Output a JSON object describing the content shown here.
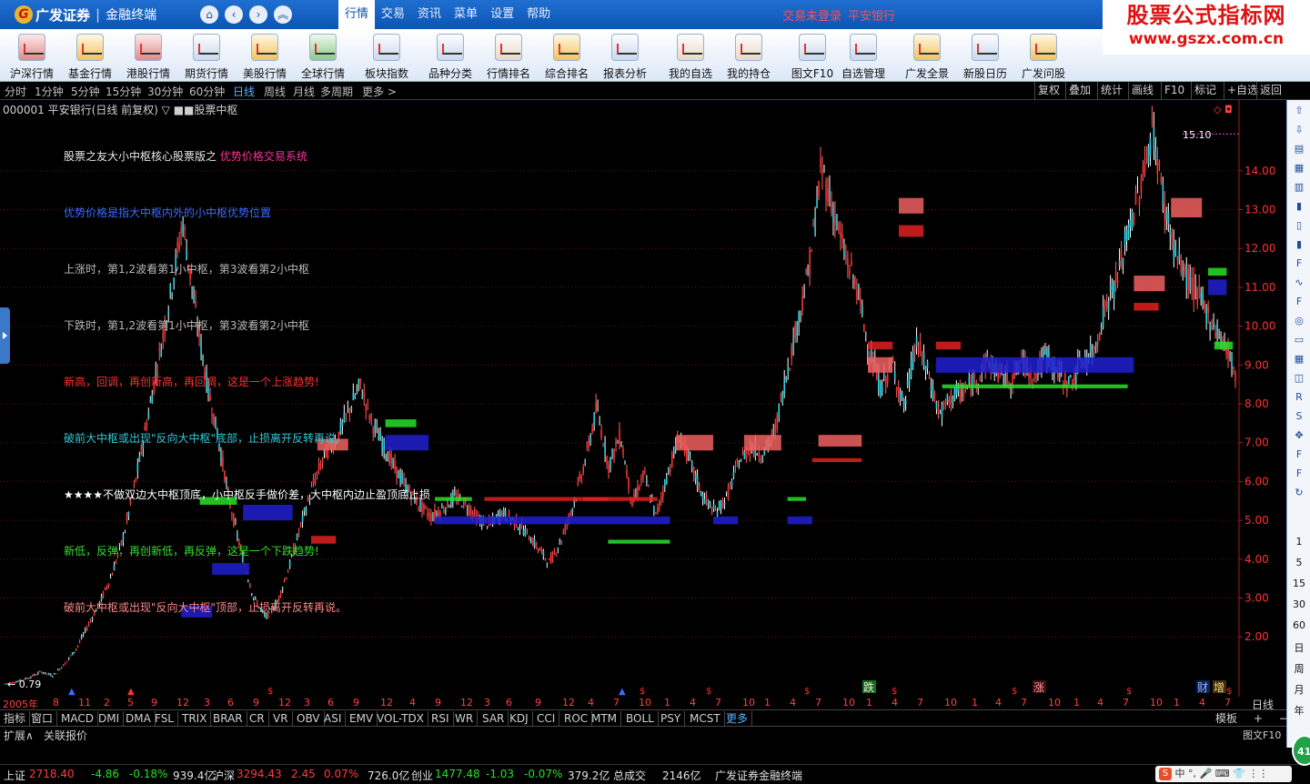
{
  "titlebar": {
    "brand": "广发证券",
    "product": "金融终端",
    "logo_char": "G",
    "menu": [
      "行情",
      "交易",
      "资讯",
      "菜单",
      "设置",
      "帮助"
    ],
    "login_status": "交易未登录",
    "current_stock": "平安银行"
  },
  "watermark": {
    "line1": "股票公式指标网",
    "line2": "www.gszx.com.cn"
  },
  "toolbar": [
    {
      "label": "沪深行情",
      "icon": "shsz-quotes-icon"
    },
    {
      "label": "基金行情",
      "icon": "fund-quotes-icon"
    },
    {
      "label": "港股行情",
      "icon": "hk-quotes-icon"
    },
    {
      "label": "期货行情",
      "icon": "futures-quotes-icon"
    },
    {
      "label": "美股行情",
      "icon": "us-quotes-icon"
    },
    {
      "label": "全球行情",
      "icon": "global-quotes-icon"
    },
    {
      "label": "板块指数",
      "icon": "sector-index-icon"
    },
    {
      "label": "品种分类",
      "icon": "category-icon"
    },
    {
      "label": "行情排名",
      "icon": "ranking-icon"
    },
    {
      "label": "综合排名",
      "icon": "composite-ranking-icon"
    },
    {
      "label": "报表分析",
      "icon": "report-analysis-icon"
    },
    {
      "label": "我的自选",
      "icon": "my-watchlist-icon"
    },
    {
      "label": "我的持仓",
      "icon": "my-holdings-icon"
    },
    {
      "label": "图文F10",
      "icon": "f10-icon"
    },
    {
      "label": "自选管理",
      "icon": "watchlist-manage-icon"
    },
    {
      "label": "广发全景",
      "icon": "gf-panorama-icon"
    },
    {
      "label": "新股日历",
      "icon": "ipo-calendar-icon"
    },
    {
      "label": "广发问股",
      "icon": "gf-ask-icon"
    }
  ],
  "periods": [
    "分时",
    "1分钟",
    "5分钟",
    "15分钟",
    "30分钟",
    "60分钟",
    "日线",
    "周线",
    "月线",
    "多周期",
    "更多 >"
  ],
  "active_period": "日线",
  "right_buttons": [
    "复权",
    "叠加",
    "统计",
    "画线",
    "F10",
    "标记",
    "+自选",
    "返回"
  ],
  "chart_header": {
    "code": "000001",
    "name": "平安银行(日线 前复权)",
    "indicator": "▽ ■■股票中枢"
  },
  "notes": [
    {
      "text": "股票之友大小中枢核心股票版之 ",
      "extra": "优势价格交易系统",
      "color": "#e8e8e8",
      "extra_color": "#ff3399"
    },
    {
      "text": "优势价格是指大中枢内外的小中枢优势位置",
      "color": "#3b6bff"
    },
    {
      "text": "上涨时，第1,2波看第1小中枢，第3波看第2小中枢",
      "color": "#b8b8b8"
    },
    {
      "text": "下跌时，第1,2波看第1小中枢，第3波看第2小中枢",
      "color": "#b8b8b8"
    },
    {
      "text": "新高，回调，再创新高，再回调，这是一个上涨趋势!",
      "color": "#ff3030"
    },
    {
      "text": "破前大中枢或出现\"反向大中枢\"底部，止损离开反转再说。",
      "color": "#30c8d8"
    },
    {
      "text": "★★★★不做双边大中枢顶底，小中枢反手做价差，大中枢内边止盈顶底止损",
      "color": "#ffffff"
    },
    {
      "text": "新低，反弹，再创新低，再反弹，这是一个下跌趋势!",
      "color": "#30e030"
    },
    {
      "text": "破前大中枢或出现\"反向大中枢\"顶部，止损离开反转再说。",
      "color": "#ff8888"
    }
  ],
  "chart_data": {
    "type": "line",
    "title": "000001 平安银行(日线 前复权)",
    "ylim": [
      0.6,
      15.4
    ],
    "y_ticks": [
      "14.00",
      "13.00",
      "12.00",
      "11.00",
      "10.00",
      "9.00",
      "8.00",
      "7.00",
      "6.00",
      "5.00",
      "4.00",
      "3.00",
      "2.00"
    ],
    "max_label": "15.10",
    "min_label": "0.79",
    "x_ticks": [
      "2005年",
      "8",
      "11",
      "2",
      "5",
      "9",
      "12",
      "3",
      "6",
      "9",
      "12",
      "3",
      "6",
      "9",
      "12",
      "4",
      "9",
      "12",
      "3",
      "6",
      "9",
      "12",
      "4",
      "7",
      "10",
      "1",
      "4",
      "7",
      "10",
      "1",
      "4",
      "7",
      "10",
      "1",
      "4",
      "7",
      "10",
      "1",
      "4",
      "7",
      "10",
      "1",
      "4",
      "7",
      "10",
      "1",
      "4",
      "7",
      "10",
      "1",
      "4",
      "7"
    ],
    "period_label": "日线",
    "series": [
      {
        "values": [
          0.79,
          0.85,
          0.95,
          1.1,
          1.0,
          1.3,
          1.7,
          2.3,
          2.9,
          3.6,
          4.6,
          6.0,
          7.6,
          9.2,
          10.9,
          12.7,
          10.5,
          8.6,
          7.1,
          5.4,
          4.1,
          3.0,
          2.5,
          2.9,
          3.8,
          4.9,
          5.9,
          6.7,
          7.1,
          7.8,
          8.5,
          7.5,
          6.9,
          6.3,
          5.8,
          5.4,
          5.1,
          5.3,
          5.6,
          5.4,
          5.0,
          4.9,
          5.2,
          5.0,
          4.7,
          4.3,
          3.9,
          4.5,
          5.4,
          6.5,
          7.9,
          6.4,
          7.2,
          5.4,
          6.2,
          5.1,
          6.2,
          7.2,
          6.4,
          5.6,
          5.2,
          5.6,
          6.5,
          6.9,
          6.7,
          7.2,
          8.7,
          10.1,
          11.6,
          14.1,
          13.0,
          11.8,
          11.0,
          9.4,
          8.4,
          9.0,
          7.9,
          9.6,
          8.8,
          7.7,
          8.2,
          8.3,
          8.6,
          9.1,
          8.8,
          8.6,
          9.1,
          8.7,
          9.3,
          8.8,
          8.5,
          9.1,
          9.3,
          10.5,
          11.2,
          12.5,
          13.6,
          15.1,
          13.1,
          11.8,
          11.2,
          10.7,
          10.1,
          9.6,
          8.8
        ]
      }
    ]
  },
  "bottom_markers": [
    "跌",
    "涨",
    "财",
    "增"
  ],
  "indicator_tabs": [
    "指标",
    "窗口",
    "MACD",
    "DMI",
    "DMA",
    "FSL",
    "TRIX",
    "BRAR",
    "CR",
    "VR",
    "OBV",
    "ASI",
    "EMV",
    "VOL-TDX",
    "RSI",
    "WR",
    "SAR",
    "KDJ",
    "CCI",
    "ROC",
    "MTM",
    "BOLL",
    "PSY",
    "MCST",
    "更多"
  ],
  "template_buttons": [
    "模板",
    "+",
    "−"
  ],
  "expand_row": [
    "扩展∧",
    "关联报价"
  ],
  "f10_label": "图文F10",
  "rightbar_numbers": [
    "1",
    "5",
    "15",
    "30",
    "60",
    "日",
    "周",
    "月",
    "年"
  ],
  "status": {
    "sh_label": "上证",
    "sh_value": "2718.40",
    "sh_change": "-4.86",
    "sh_pct": "-0.18%",
    "sh_amount": "939.4亿",
    "sz_label": "沪深",
    "sz_value": "3294.43",
    "sz_change": "2.45",
    "sz_pct": "0.07%",
    "sz_amount": "726.0亿",
    "cy_label": "创业",
    "cy_value": "1477.48",
    "cy_change": "-1.03",
    "cy_pct": "-0.07%",
    "cy_amount": "379.2亿",
    "total_label": "总成交",
    "total_value": "2146亿",
    "app_name": "广发证券金融终端",
    "ime": "中",
    "badge": "41"
  },
  "colors": {
    "up": "#ff3030",
    "down": "#28e028",
    "accent": "#1f6fd0"
  }
}
